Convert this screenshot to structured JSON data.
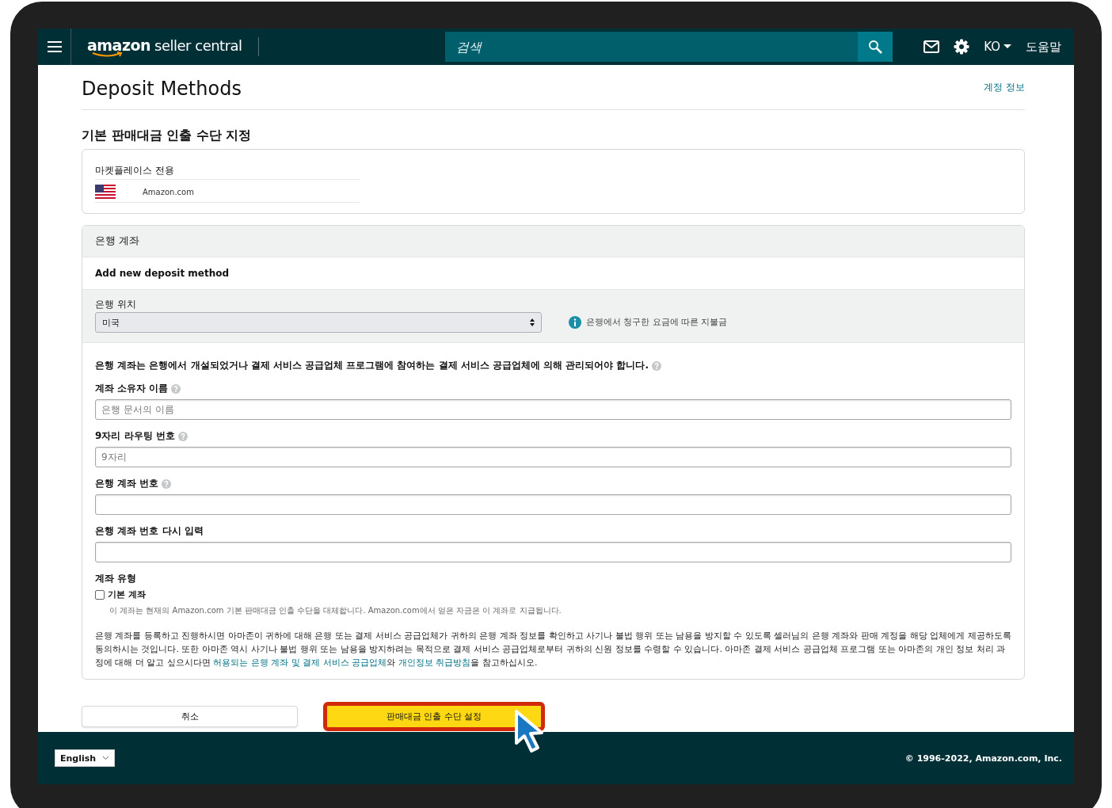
{
  "header": {
    "logo": {
      "brand": "amazon",
      "product": "seller central"
    },
    "search": {
      "placeholder": "검색"
    },
    "language": "KO",
    "help": "도움말"
  },
  "page": {
    "title": "Deposit Methods",
    "account_link": "계정 정보"
  },
  "default_section": {
    "heading": "기본 판매대금 인출 수단 지정",
    "marketplace_label": "마켓플레이스 전용",
    "marketplace": "Amazon.com"
  },
  "bank_panel": {
    "title": "은행 계좌",
    "subtitle": "Add new deposit method",
    "location_label": "은행 위치",
    "location_value": "미국",
    "fee_note": "은행에서 청구한 요금에 따른 지불금",
    "requirement": "은행 계좌는 은행에서 개설되었거나 결제 서비스 공급업체 프로그램에 참여하는 결제 서비스 공급업체에 의해 관리되어야 합니다.",
    "fields": [
      {
        "label": "계좌 소유자 이름",
        "help": true,
        "placeholder": "은행 문서의 이름"
      },
      {
        "label": "9자리 라우팅 번호",
        "help": true,
        "placeholder": "9자리"
      },
      {
        "label": "은행 계좌 번호",
        "help": true
      },
      {
        "label": "은행 계좌 번호 다시 입력",
        "help": false
      }
    ],
    "account_type_label": "계좌 유형",
    "default_checkbox": {
      "label": "기본 계좌",
      "checked": false,
      "note": "이 계좌는 현재의 Amazon.com 기본 판매대금 인출 수단을 대체합니다. Amazon.com에서 얻은 자금은 이 계좌로 지급됩니다."
    },
    "consent": [
      {
        "kind": "text",
        "text": "은행 계좌를 등록하고 진행하시면 아마존이 귀하에 대해 은행 또는 결제 서비스 공급업체가 귀하의 은행 계좌 정보를 확인하고 사기나 불법 행위 또는 남용을 방지할 수 있도록 셀러님의 은행 계좌와 판매 계정을 해당 업체에게 제공하도록 동의하시는 것입니다. 또한 아마존 역시 사기나 불법 행위 또는 남용을 방지하려는 목적으로 결제 서비스 공급업체로부터 귀하의 신원 정보를 수령할 수 있습니다. 아마존 결제 서비스 공급업체 프로그램 또는 아마존의 개인 정보 처리 과정에 대해 더 알고 싶으시다면 "
      },
      {
        "kind": "link",
        "text": "허용되는 은행 계좌 및 결제 서비스 공급업체"
      },
      {
        "kind": "text",
        "text": "와 "
      },
      {
        "kind": "link",
        "text": "개인정보 취급방침"
      },
      {
        "kind": "text",
        "text": "을 참고하십시오."
      }
    ]
  },
  "buttons": {
    "cancel": "취소",
    "submit": "판매대금 인출 수단 설정"
  },
  "footer": {
    "language": "English",
    "copyright": "© 1996-2022, Amazon.com, Inc."
  }
}
